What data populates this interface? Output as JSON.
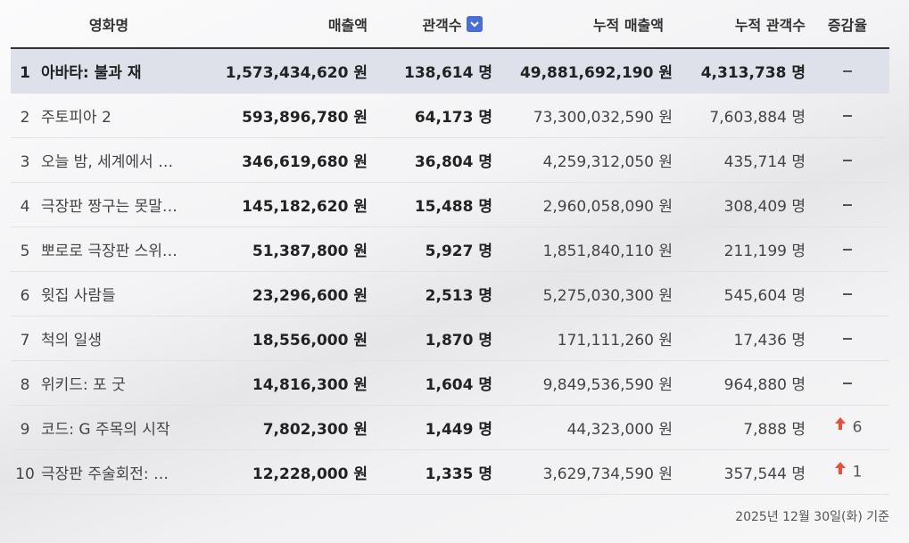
{
  "table": {
    "headers": {
      "title": "영화명",
      "revenue": "매출액",
      "audience": "관객수",
      "cum_revenue": "누적 매출액",
      "cum_audience": "누적 관객수",
      "change": "증감율"
    },
    "sort_icon": "chevron-down-icon",
    "rows": [
      {
        "rank": "1",
        "title": "아바타: 불과 재",
        "revenue": "1,573,434,620 원",
        "audience": "138,614 명",
        "cum_revenue": "49,881,692,190 원",
        "cum_audience": "4,313,738 명",
        "change": "-",
        "change_dir": "none",
        "change_value": ""
      },
      {
        "rank": "2",
        "title": "주토피아 2",
        "revenue": "593,896,780 원",
        "audience": "64,173 명",
        "cum_revenue": "73,300,032,590 원",
        "cum_audience": "7,603,884 명",
        "change": "-",
        "change_dir": "none",
        "change_value": ""
      },
      {
        "rank": "3",
        "title": "오늘 밤, 세계에서 …",
        "revenue": "346,619,680 원",
        "audience": "36,804 명",
        "cum_revenue": "4,259,312,050 원",
        "cum_audience": "435,714 명",
        "change": "-",
        "change_dir": "none",
        "change_value": ""
      },
      {
        "rank": "4",
        "title": "극장판 짱구는 못말…",
        "revenue": "145,182,620 원",
        "audience": "15,488 명",
        "cum_revenue": "2,960,058,090 원",
        "cum_audience": "308,409 명",
        "change": "-",
        "change_dir": "none",
        "change_value": ""
      },
      {
        "rank": "5",
        "title": "뽀로로 극장판 스위…",
        "revenue": "51,387,800 원",
        "audience": "5,927 명",
        "cum_revenue": "1,851,840,110 원",
        "cum_audience": "211,199 명",
        "change": "-",
        "change_dir": "none",
        "change_value": ""
      },
      {
        "rank": "6",
        "title": "윗집 사람들",
        "revenue": "23,296,600 원",
        "audience": "2,513 명",
        "cum_revenue": "5,275,030,300 원",
        "cum_audience": "545,604 명",
        "change": "-",
        "change_dir": "none",
        "change_value": ""
      },
      {
        "rank": "7",
        "title": "척의 일생",
        "revenue": "18,556,000 원",
        "audience": "1,870 명",
        "cum_revenue": "171,111,260 원",
        "cum_audience": "17,436 명",
        "change": "-",
        "change_dir": "none",
        "change_value": ""
      },
      {
        "rank": "8",
        "title": "위키드: 포 굿",
        "revenue": "14,816,300 원",
        "audience": "1,604 명",
        "cum_revenue": "9,849,536,590 원",
        "cum_audience": "964,880 명",
        "change": "-",
        "change_dir": "none",
        "change_value": ""
      },
      {
        "rank": "9",
        "title": "코드: G 주목의 시작",
        "revenue": "7,802,300 원",
        "audience": "1,449 명",
        "cum_revenue": "44,323,000 원",
        "cum_audience": "7,888 명",
        "change": "",
        "change_dir": "up",
        "change_value": "6"
      },
      {
        "rank": "10",
        "title": "극장판 주술회전: …",
        "revenue": "12,228,000 원",
        "audience": "1,335 명",
        "cum_revenue": "3,629,734,590 원",
        "cum_audience": "357,544 명",
        "change": "",
        "change_dir": "up",
        "change_value": "1"
      }
    ]
  },
  "footer": {
    "date_note": "2025년 12월 30일(화) 기준"
  },
  "colors": {
    "highlight_row": "#dee1ea",
    "up_arrow": "#e8503a",
    "sort_button": "#4a6fd4"
  }
}
